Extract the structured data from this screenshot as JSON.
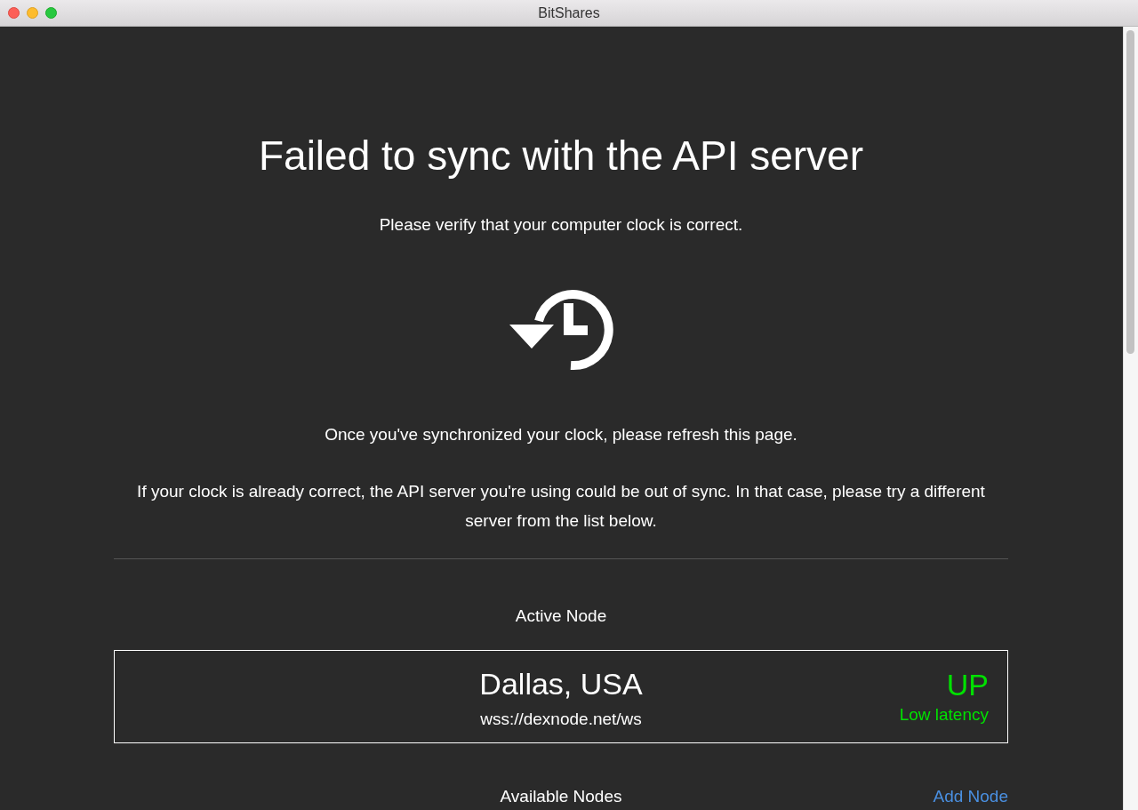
{
  "window": {
    "title": "BitShares"
  },
  "heading": "Failed to sync with the API server",
  "subtitle": "Please verify that your computer clock is correct.",
  "paragraphs": [
    "Once you've synchronized your clock, please refresh this page.",
    "If your clock is already correct, the API server you're using could be out of sync. In that case, please try a different server from the list below."
  ],
  "active_node": {
    "label": "Active Node",
    "name": "Dallas, USA",
    "url": "wss://dexnode.net/ws",
    "status": "UP",
    "latency": "Low latency",
    "online": true
  },
  "available_nodes": {
    "label": "Available Nodes",
    "add_link": "Add Node"
  }
}
